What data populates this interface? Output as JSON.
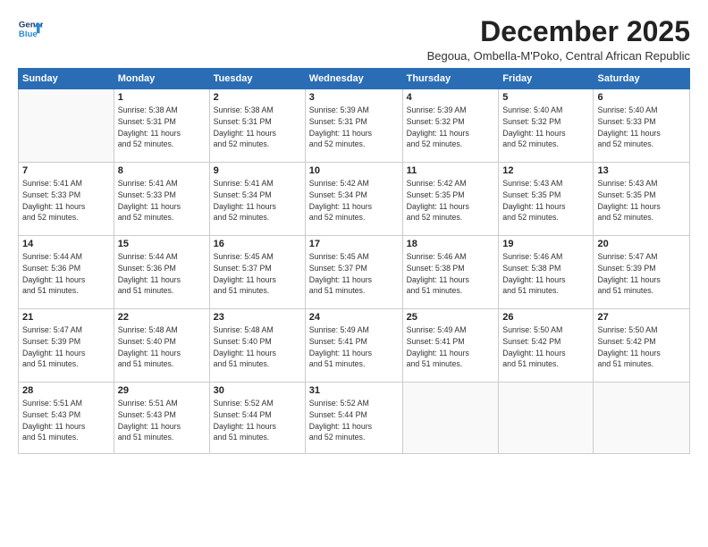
{
  "logo": {
    "line1": "General",
    "line2": "Blue"
  },
  "title": "December 2025",
  "subtitle": "Begoua, Ombella-M'Poko, Central African Republic",
  "days_of_week": [
    "Sunday",
    "Monday",
    "Tuesday",
    "Wednesday",
    "Thursday",
    "Friday",
    "Saturday"
  ],
  "weeks": [
    [
      {
        "day": "",
        "detail": ""
      },
      {
        "day": "1",
        "detail": "Sunrise: 5:38 AM\nSunset: 5:31 PM\nDaylight: 11 hours\nand 52 minutes."
      },
      {
        "day": "2",
        "detail": "Sunrise: 5:38 AM\nSunset: 5:31 PM\nDaylight: 11 hours\nand 52 minutes."
      },
      {
        "day": "3",
        "detail": "Sunrise: 5:39 AM\nSunset: 5:31 PM\nDaylight: 11 hours\nand 52 minutes."
      },
      {
        "day": "4",
        "detail": "Sunrise: 5:39 AM\nSunset: 5:32 PM\nDaylight: 11 hours\nand 52 minutes."
      },
      {
        "day": "5",
        "detail": "Sunrise: 5:40 AM\nSunset: 5:32 PM\nDaylight: 11 hours\nand 52 minutes."
      },
      {
        "day": "6",
        "detail": "Sunrise: 5:40 AM\nSunset: 5:33 PM\nDaylight: 11 hours\nand 52 minutes."
      }
    ],
    [
      {
        "day": "7",
        "detail": "Sunrise: 5:41 AM\nSunset: 5:33 PM\nDaylight: 11 hours\nand 52 minutes."
      },
      {
        "day": "8",
        "detail": "Sunrise: 5:41 AM\nSunset: 5:33 PM\nDaylight: 11 hours\nand 52 minutes."
      },
      {
        "day": "9",
        "detail": "Sunrise: 5:41 AM\nSunset: 5:34 PM\nDaylight: 11 hours\nand 52 minutes."
      },
      {
        "day": "10",
        "detail": "Sunrise: 5:42 AM\nSunset: 5:34 PM\nDaylight: 11 hours\nand 52 minutes."
      },
      {
        "day": "11",
        "detail": "Sunrise: 5:42 AM\nSunset: 5:35 PM\nDaylight: 11 hours\nand 52 minutes."
      },
      {
        "day": "12",
        "detail": "Sunrise: 5:43 AM\nSunset: 5:35 PM\nDaylight: 11 hours\nand 52 minutes."
      },
      {
        "day": "13",
        "detail": "Sunrise: 5:43 AM\nSunset: 5:35 PM\nDaylight: 11 hours\nand 52 minutes."
      }
    ],
    [
      {
        "day": "14",
        "detail": "Sunrise: 5:44 AM\nSunset: 5:36 PM\nDaylight: 11 hours\nand 51 minutes."
      },
      {
        "day": "15",
        "detail": "Sunrise: 5:44 AM\nSunset: 5:36 PM\nDaylight: 11 hours\nand 51 minutes."
      },
      {
        "day": "16",
        "detail": "Sunrise: 5:45 AM\nSunset: 5:37 PM\nDaylight: 11 hours\nand 51 minutes."
      },
      {
        "day": "17",
        "detail": "Sunrise: 5:45 AM\nSunset: 5:37 PM\nDaylight: 11 hours\nand 51 minutes."
      },
      {
        "day": "18",
        "detail": "Sunrise: 5:46 AM\nSunset: 5:38 PM\nDaylight: 11 hours\nand 51 minutes."
      },
      {
        "day": "19",
        "detail": "Sunrise: 5:46 AM\nSunset: 5:38 PM\nDaylight: 11 hours\nand 51 minutes."
      },
      {
        "day": "20",
        "detail": "Sunrise: 5:47 AM\nSunset: 5:39 PM\nDaylight: 11 hours\nand 51 minutes."
      }
    ],
    [
      {
        "day": "21",
        "detail": "Sunrise: 5:47 AM\nSunset: 5:39 PM\nDaylight: 11 hours\nand 51 minutes."
      },
      {
        "day": "22",
        "detail": "Sunrise: 5:48 AM\nSunset: 5:40 PM\nDaylight: 11 hours\nand 51 minutes."
      },
      {
        "day": "23",
        "detail": "Sunrise: 5:48 AM\nSunset: 5:40 PM\nDaylight: 11 hours\nand 51 minutes."
      },
      {
        "day": "24",
        "detail": "Sunrise: 5:49 AM\nSunset: 5:41 PM\nDaylight: 11 hours\nand 51 minutes."
      },
      {
        "day": "25",
        "detail": "Sunrise: 5:49 AM\nSunset: 5:41 PM\nDaylight: 11 hours\nand 51 minutes."
      },
      {
        "day": "26",
        "detail": "Sunrise: 5:50 AM\nSunset: 5:42 PM\nDaylight: 11 hours\nand 51 minutes."
      },
      {
        "day": "27",
        "detail": "Sunrise: 5:50 AM\nSunset: 5:42 PM\nDaylight: 11 hours\nand 51 minutes."
      }
    ],
    [
      {
        "day": "28",
        "detail": "Sunrise: 5:51 AM\nSunset: 5:43 PM\nDaylight: 11 hours\nand 51 minutes."
      },
      {
        "day": "29",
        "detail": "Sunrise: 5:51 AM\nSunset: 5:43 PM\nDaylight: 11 hours\nand 51 minutes."
      },
      {
        "day": "30",
        "detail": "Sunrise: 5:52 AM\nSunset: 5:44 PM\nDaylight: 11 hours\nand 51 minutes."
      },
      {
        "day": "31",
        "detail": "Sunrise: 5:52 AM\nSunset: 5:44 PM\nDaylight: 11 hours\nand 52 minutes."
      },
      {
        "day": "",
        "detail": ""
      },
      {
        "day": "",
        "detail": ""
      },
      {
        "day": "",
        "detail": ""
      }
    ]
  ]
}
